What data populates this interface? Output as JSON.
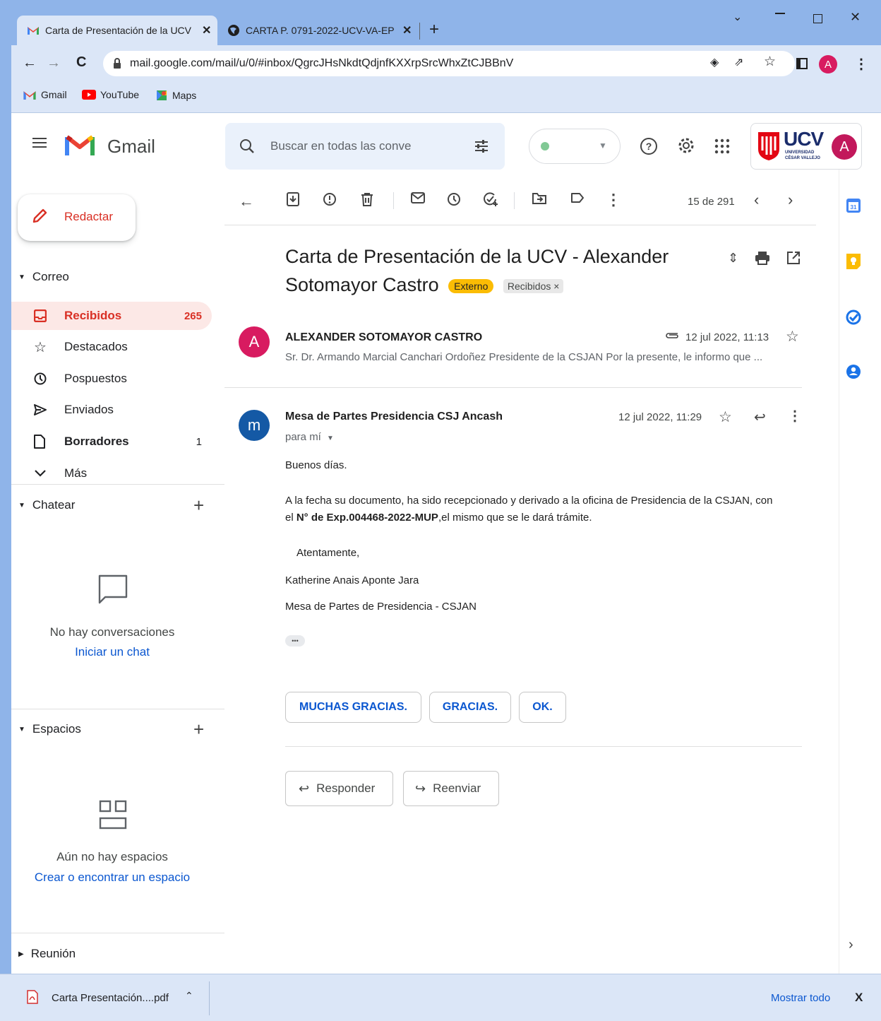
{
  "browser": {
    "tabs": [
      {
        "title": "Carta de Presentación de la UCV",
        "active": true
      },
      {
        "title": "CARTA P. 0791-2022-UCV-VA-EP",
        "active": false
      }
    ],
    "url": "mail.google.com/mail/u/0/#inbox/QgrcJHsNkdtQdjnfKXXrpSrcWhxZtCJBBnV",
    "bookmarks": [
      {
        "label": "Gmail",
        "icon": "gmail-logo-icon"
      },
      {
        "label": "YouTube",
        "icon": "youtube-icon"
      },
      {
        "label": "Maps",
        "icon": "maps-icon"
      }
    ],
    "profile_initial": "A",
    "accent": "#8fb4e9"
  },
  "gmail": {
    "logo_text": "Gmail",
    "search_placeholder": "Buscar en todas las conve",
    "org_logo": {
      "main": "UCV",
      "sub1": "UNIVERSIDAD",
      "sub2": "CÉSAR VALLEJO"
    },
    "avatar_initial": "A",
    "compose_label": "Redactar",
    "mail_section": "Correo",
    "nav": [
      {
        "label": "Recibidos",
        "count": "265",
        "icon": "inbox-icon",
        "active": true,
        "bold": true
      },
      {
        "label": "Destacados",
        "count": "",
        "icon": "star-icon",
        "active": false,
        "bold": false
      },
      {
        "label": "Pospuestos",
        "count": "",
        "icon": "clock-icon",
        "active": false,
        "bold": false
      },
      {
        "label": "Enviados",
        "count": "",
        "icon": "send-icon",
        "active": false,
        "bold": false
      },
      {
        "label": "Borradores",
        "count": "1",
        "icon": "draft-icon",
        "active": false,
        "bold": true
      },
      {
        "label": "Más",
        "count": "",
        "icon": "chevron-down-icon",
        "active": false,
        "bold": false
      }
    ],
    "chat": {
      "title": "Chatear",
      "empty": "No hay conversaciones",
      "link": "Iniciar un chat"
    },
    "spaces": {
      "title": "Espacios",
      "empty": "Aún no hay espacios",
      "link": "Crear o encontrar un espacio"
    },
    "meet": {
      "title": "Reunión"
    },
    "pager": "15 de 291",
    "subject_line1": "Carta de Presentación de la UCV - Alexander",
    "subject_line2": "Sotomayor Castro",
    "labels": {
      "external": "Externo",
      "inbox": "Recibidos",
      "inbox_remove": "×"
    },
    "messages": [
      {
        "avatar": "A",
        "sender": "ALEXANDER SOTOMAYOR CASTRO",
        "date": "12 jul 2022, 11:13",
        "snippet": "Sr. Dr. Armando Marcial Canchari Ordoñez Presidente de la CSJAN Por la presente, le informo que ..."
      },
      {
        "avatar": "m",
        "sender": "Mesa de Partes Presidencia CSJ Ancash",
        "date": "12 jul 2022, 11:29",
        "to": "para mí",
        "greeting": "Buenos días.",
        "p1_a": "A la fecha su documento,  ha sido recepcionado y derivado a la oficina de Presidencia de la CSJAN, con",
        "p1_b_pre": "el ",
        "p1_b_bold": "N° de Exp.004468-2022-MUP",
        "p1_b_post": ",el mismo que se le dará trámite.",
        "closing": "Atentamente,",
        "signature_name": "Katherine Anais Aponte Jara",
        "signature_org": "Mesa de Partes de Presidencia - CSJAN",
        "ellipsis": "•••"
      }
    ],
    "smart_replies": [
      "MUCHAS GRACIAS.",
      "GRACIAS.",
      "OK."
    ],
    "reply_label": "Responder",
    "forward_label": "Reenviar"
  },
  "download": {
    "file": "Carta Presentación....pdf",
    "show_all": "Mostrar todo",
    "close": "X"
  }
}
